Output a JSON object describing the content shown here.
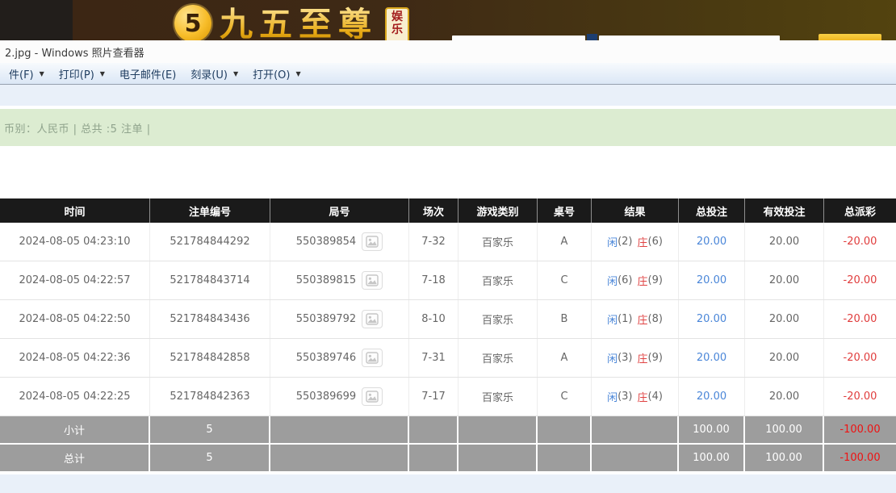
{
  "banner": {
    "logo_number": "5",
    "brand": "九五至尊",
    "badge_top": "娱",
    "badge_bottom": "乐"
  },
  "viewer": {
    "title": "2.jpg - Windows 照片查看器",
    "menu": {
      "items": [
        {
          "label": "件(F)",
          "arrow": "▼"
        },
        {
          "label": "打印(P)",
          "arrow": "▼"
        },
        {
          "label": "电子邮件(E)",
          "arrow": ""
        },
        {
          "label": "刻录(U)",
          "arrow": "▼"
        },
        {
          "label": "打开(O)",
          "arrow": "▼"
        }
      ]
    }
  },
  "info_bar": {
    "text": "币别：人民币 | 总共 :5 注单 |"
  },
  "table": {
    "headers": [
      "时间",
      "注单编号",
      "局号",
      "场次",
      "游戏类别",
      "桌号",
      "结果",
      "总投注",
      "有效投注",
      "总派彩"
    ],
    "rows": [
      {
        "time": "2024-08-05 04:23:10",
        "bet_id": "521784844292",
        "round_id": "550389854",
        "session": "7-32",
        "game_type": "百家乐",
        "table_no": "A",
        "result_player": "闲",
        "result_player_pts": "(2)",
        "result_banker": "庄",
        "result_banker_pts": "(6)",
        "total_bet": "20.00",
        "valid_bet": "20.00",
        "payout": "-20.00"
      },
      {
        "time": "2024-08-05 04:22:57",
        "bet_id": "521784843714",
        "round_id": "550389815",
        "session": "7-18",
        "game_type": "百家乐",
        "table_no": "C",
        "result_player": "闲",
        "result_player_pts": "(6)",
        "result_banker": "庄",
        "result_banker_pts": "(9)",
        "total_bet": "20.00",
        "valid_bet": "20.00",
        "payout": "-20.00"
      },
      {
        "time": "2024-08-05 04:22:50",
        "bet_id": "521784843436",
        "round_id": "550389792",
        "session": "8-10",
        "game_type": "百家乐",
        "table_no": "B",
        "result_player": "闲",
        "result_player_pts": "(1)",
        "result_banker": "庄",
        "result_banker_pts": "(8)",
        "total_bet": "20.00",
        "valid_bet": "20.00",
        "payout": "-20.00"
      },
      {
        "time": "2024-08-05 04:22:36",
        "bet_id": "521784842858",
        "round_id": "550389746",
        "session": "7-31",
        "game_type": "百家乐",
        "table_no": "A",
        "result_player": "闲",
        "result_player_pts": "(3)",
        "result_banker": "庄",
        "result_banker_pts": "(9)",
        "total_bet": "20.00",
        "valid_bet": "20.00",
        "payout": "-20.00"
      },
      {
        "time": "2024-08-05 04:22:25",
        "bet_id": "521784842363",
        "round_id": "550389699",
        "session": "7-17",
        "game_type": "百家乐",
        "table_no": "C",
        "result_player": "闲",
        "result_player_pts": "(3)",
        "result_banker": "庄",
        "result_banker_pts": "(4)",
        "total_bet": "20.00",
        "valid_bet": "20.00",
        "payout": "-20.00"
      }
    ],
    "subtotal": {
      "label": "小计",
      "count": "5",
      "total_bet": "100.00",
      "valid_bet": "100.00",
      "payout": "-100.00"
    },
    "total": {
      "label": "总计",
      "count": "5",
      "total_bet": "100.00",
      "valid_bet": "100.00",
      "payout": "-100.00"
    }
  },
  "colors": {
    "accent_blue": "#4a86d8",
    "accent_red": "#e03c3c",
    "summary_red": "#ef1212",
    "gold": "#f2b42a",
    "header_bg": "#1a1a1a",
    "summary_bg": "#9d9d9d",
    "info_bar_bg": "#dcecd1",
    "banner_brown": "#3b2514"
  }
}
